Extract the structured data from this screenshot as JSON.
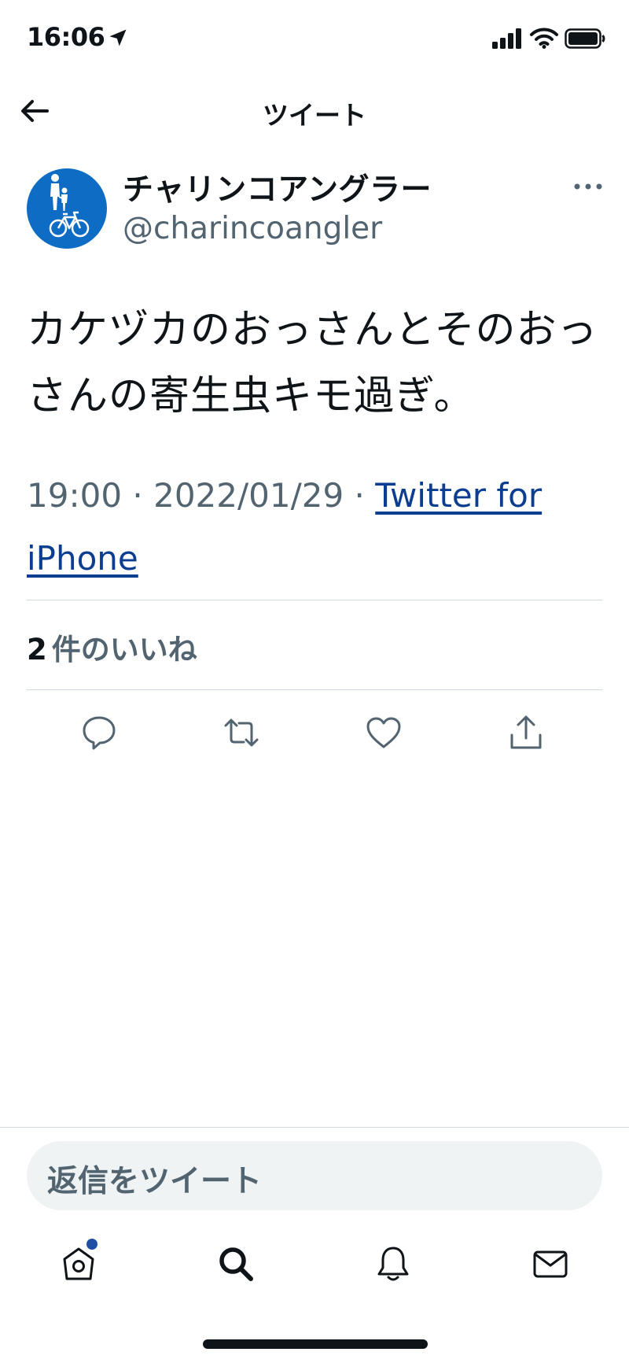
{
  "status_bar": {
    "time": "16:06"
  },
  "nav": {
    "title": "ツイート"
  },
  "tweet": {
    "display_name": "チャリンコアングラー",
    "handle": "@charincoangler",
    "text": "カケヅカのおっさんとそのおっさんの寄生虫キモ過ぎ。",
    "time": "19:00",
    "separator": " · ",
    "date": "2022/01/29",
    "source": "Twitter for iPhone",
    "like_count": "2",
    "like_label": "件のいいね"
  },
  "reply": {
    "placeholder": "返信をツイート"
  },
  "colors": {
    "avatar_bg": "#0f6cc4",
    "link": "#0b3d91",
    "secondary_text": "#536471",
    "notification_dot": "#1d4fa5"
  },
  "icons": {
    "back": "arrow-left-icon",
    "more": "more-horizontal-icon",
    "reply": "reply-icon",
    "retweet": "retweet-icon",
    "like": "heart-icon",
    "share": "share-icon",
    "tabs": [
      "home-icon",
      "search-icon",
      "bell-icon",
      "mail-icon"
    ]
  }
}
